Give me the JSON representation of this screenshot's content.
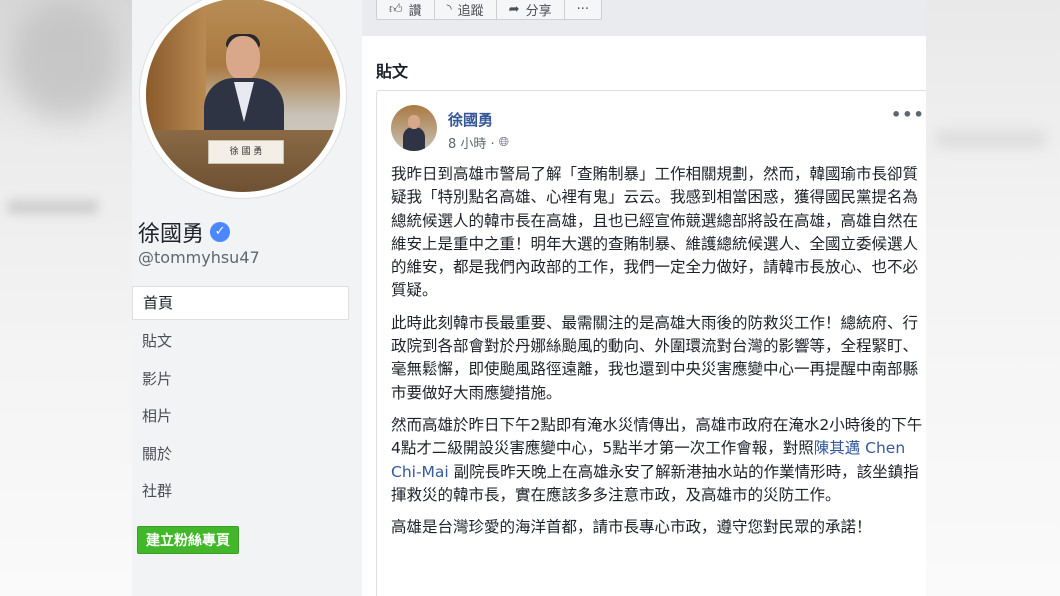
{
  "sidebar": {
    "avatar_plate": "徐 國 勇",
    "page_name": "徐國勇",
    "handle": "@tommyhsu47",
    "nav": [
      "首頁",
      "貼文",
      "影片",
      "相片",
      "關於",
      "社群"
    ],
    "create_button": "建立粉絲專頁"
  },
  "actions": [
    {
      "icon": "like-icon",
      "label": "讚"
    },
    {
      "icon": "rss-icon",
      "label": "追蹤"
    },
    {
      "icon": "share-icon",
      "label": "分享"
    },
    {
      "icon": "more-icon",
      "label": "···"
    }
  ],
  "posts_heading": "貼文",
  "post": {
    "author": "徐國勇",
    "time": "8 小時 ·",
    "privacy_icon": "globe-icon",
    "paragraphs": [
      "我昨日到高雄市警局了解「查賄制暴」工作相關規劃，然而，韓國瑜市長卻質疑我「特別點名高雄、心裡有鬼」云云。我感到相當困惑，獲得國民黨提名為總統候選人的韓市長在高雄，且也已經宣佈競選總部將設在高雄，高雄自然在維安上是重中之重！明年大選的查賄制暴、維護總統候選人、全國立委候選人的維安，都是我們內政部的工作，我們一定全力做好，請韓市長放心、也不必質疑。",
      "此時此刻韓市長最重要、最需關注的是高雄大雨後的防救災工作！總統府、行政院到各部會對於丹娜絲颱風的動向、外圍環流對台灣的影響等，全程緊盯、毫無鬆懈，即使颱風路徑遠離，我也還到中央災害應變中心一再提醒中南部縣市要做好大雨應變措施。"
    ],
    "para3_before": "然而高雄於昨日下午2點即有淹水災情傳出，高雄市政府在淹水2小時後的下午4點才二級開設災害應變中心，5點半才第一次工作會報，對照",
    "para3_link": "陳其邁 Chen Chi-Mai",
    "para3_after": " 副院長昨天晚上在高雄永安了解新港抽水站的作業情形時，該坐鎮指揮救災的韓市長，實在應該多多注意市政，及高雄市的災防工作。",
    "para4": "高雄是台灣珍愛的海洋首都，請市長專心市政，遵守您對民眾的承諾！"
  }
}
